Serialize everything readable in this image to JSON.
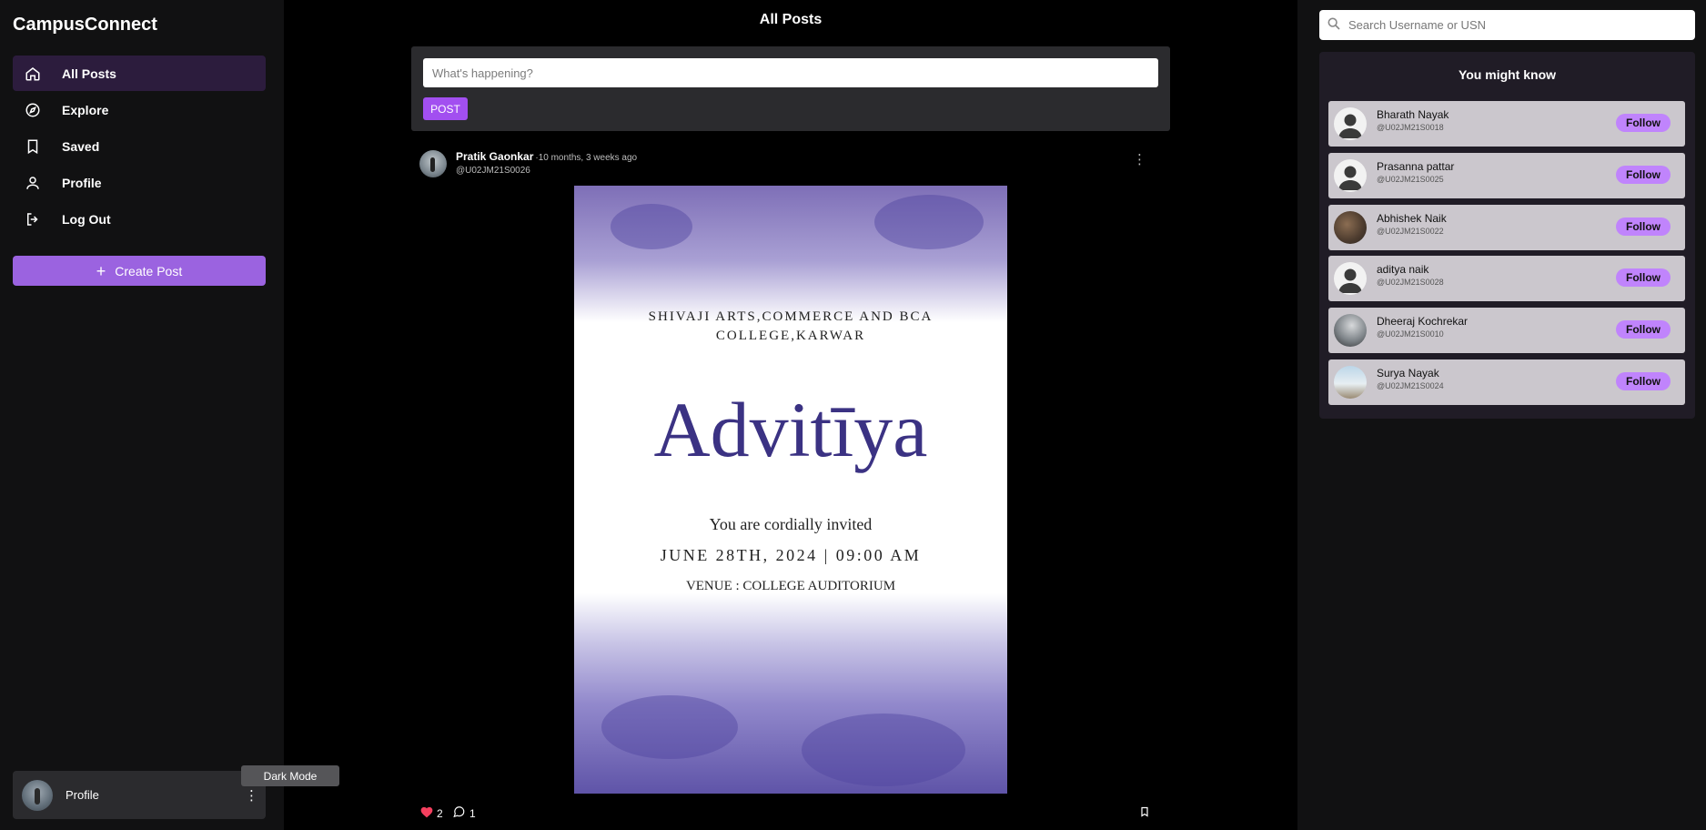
{
  "app": {
    "name": "CampusConnect"
  },
  "nav": {
    "items": [
      {
        "label": "All Posts",
        "icon": "home-icon"
      },
      {
        "label": "Explore",
        "icon": "compass-icon"
      },
      {
        "label": "Saved",
        "icon": "bookmark-icon"
      },
      {
        "label": "Profile",
        "icon": "user-icon"
      },
      {
        "label": "Log Out",
        "icon": "logout-icon"
      }
    ],
    "create_label": "Create Post"
  },
  "profile_card": {
    "label": "Profile",
    "tooltip": "Dark Mode"
  },
  "feed": {
    "title": "All Posts",
    "composer": {
      "placeholder": "What's happening?",
      "post_label": "POST"
    },
    "post": {
      "author": "Pratik Gaonkar",
      "time": "·10 months, 3 weeks ago",
      "handle": "@U02JM21S0026",
      "image": {
        "college": "SHIVAJI ARTS,COMMERCE AND BCA COLLEGE,KARWAR",
        "event": "Advitīya",
        "invite": "You are cordially invited",
        "date": "JUNE 28TH, 2024 | 09:00 AM",
        "venue": "VENUE : COLLEGE AUDITORIUM"
      },
      "likes": "2",
      "comments": "1"
    }
  },
  "search": {
    "placeholder": "Search Username or USN"
  },
  "suggestions": {
    "title": "You might know",
    "follow_label": "Follow",
    "users": [
      {
        "name": "Bharath Nayak",
        "handle": "@U02JM21S0018"
      },
      {
        "name": "Prasanna pattar",
        "handle": "@U02JM21S0025"
      },
      {
        "name": "Abhishek Naik",
        "handle": "@U02JM21S0022"
      },
      {
        "name": "aditya naik",
        "handle": "@U02JM21S0028"
      },
      {
        "name": "Dheeraj Kochrekar",
        "handle": "@U02JM21S0010"
      },
      {
        "name": "Surya Nayak",
        "handle": "@U02JM21S0024"
      }
    ]
  },
  "colors": {
    "accent": "#9b63e0",
    "post_button": "#a24ff0",
    "follow": "#c084fc",
    "active_nav": "#2c1c3d",
    "like": "#f43f5e"
  }
}
